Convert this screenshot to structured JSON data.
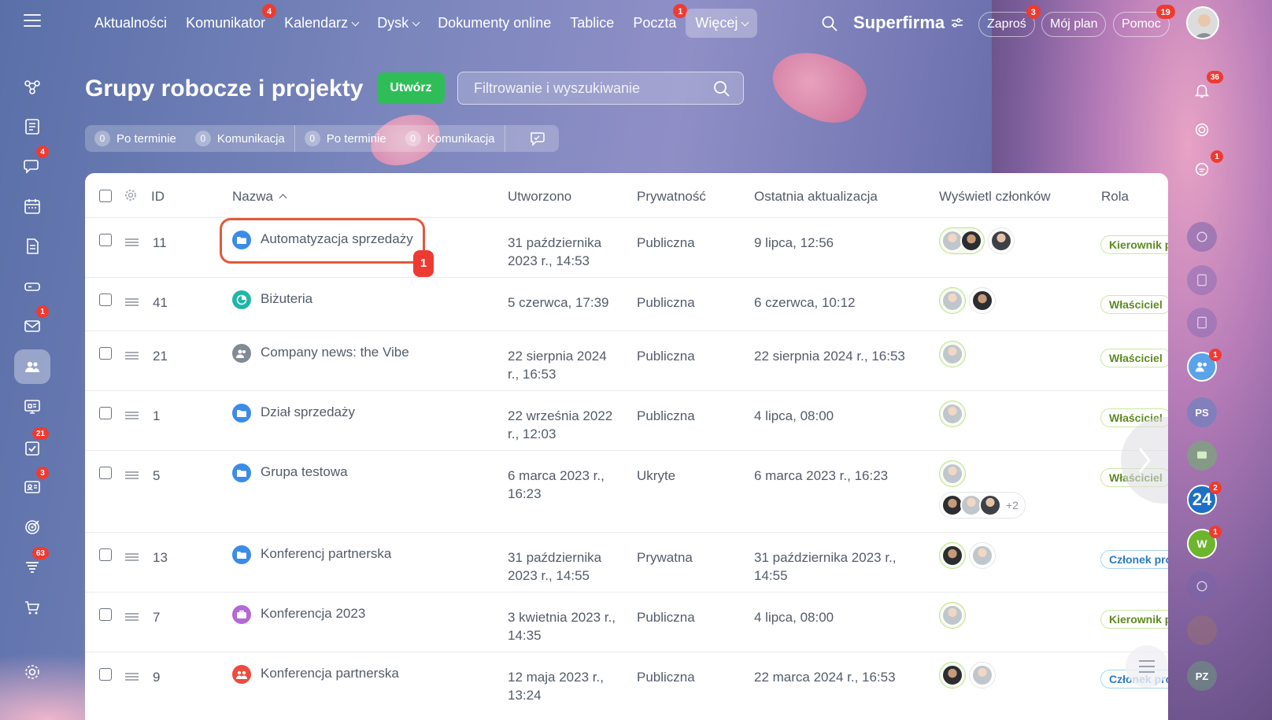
{
  "topbar": {
    "nav": [
      {
        "label": "Aktualności"
      },
      {
        "label": "Komunikator",
        "badge": "4"
      },
      {
        "label": "Kalendarz",
        "dropdown": true
      },
      {
        "label": "Dysk",
        "dropdown": true
      },
      {
        "label": "Dokumenty online"
      },
      {
        "label": "Tablice"
      },
      {
        "label": "Poczta",
        "badge": "1"
      },
      {
        "label": "Więcej",
        "dropdown": true,
        "active": true
      }
    ],
    "brand": "Superfirma",
    "invite": {
      "label": "Zaproś",
      "badge": "3"
    },
    "plan": {
      "label": "Mój plan"
    },
    "help": {
      "label": "Pomoc",
      "badge": "19"
    }
  },
  "sidebar": {
    "badges": {
      "chat": "4",
      "mail": "1",
      "tasks": "21",
      "crm": "3",
      "feed": "63"
    }
  },
  "right_sidebar": {
    "notifications_badge": "36",
    "messenger_badge": "1",
    "groups_badge": "1",
    "ps_label": "PS",
    "b24_label": "24",
    "b24_badge": "2",
    "w_label": "W",
    "w_badge": "1",
    "pz_label": "PZ"
  },
  "page": {
    "title": "Grupy robocze i projekty",
    "create_label": "Utwórz",
    "filter_placeholder": "Filtrowanie i wyszukiwanie"
  },
  "counters": [
    {
      "count": "0",
      "label": "Po terminie"
    },
    {
      "count": "0",
      "label": "Komunikacja"
    },
    {
      "count": "0",
      "label": "Po terminie"
    },
    {
      "count": "0",
      "label": "Komunikacja"
    }
  ],
  "table": {
    "headers": {
      "id": "ID",
      "name": "Nazwa",
      "created": "Utworzono",
      "privacy": "Prywatność",
      "updated": "Ostatnia aktualizacja",
      "members": "Wyświetl członków",
      "role": "Rola"
    },
    "rows": [
      {
        "id": "11",
        "name": "Automatyzacja sprzedaży",
        "created": "31 października 2023 r., 14:53",
        "privacy": "Publiczna",
        "updated": "9 lipca, 12:56",
        "role": "Kierownik projektu",
        "icon": "folder",
        "icon_color": "#3b8ce8"
      },
      {
        "id": "41",
        "name": "Biżuteria",
        "created": "5 czerwca, 17:39",
        "privacy": "Publiczna",
        "updated": "6 czerwca, 10:12",
        "role": "Właściciel",
        "icon": "pie",
        "icon_color": "#1fb7a6"
      },
      {
        "id": "21",
        "name": "Company news: the Vibe",
        "created": "22 sierpnia 2024 r., 16:53",
        "privacy": "Publiczna",
        "updated": "22 sierpnia 2024 r., 16:53",
        "role": "Właściciel",
        "icon": "people",
        "icon_color": "#828b95"
      },
      {
        "id": "1",
        "name": "Dział sprzedaży",
        "created": "22 września 2022 r., 12:03",
        "privacy": "Publiczna",
        "updated": "4 lipca, 08:00",
        "role": "Właściciel",
        "icon": "folder",
        "icon_color": "#3b8ce8"
      },
      {
        "id": "5",
        "name": "Grupa testowa",
        "created": "6 marca 2023 r., 16:23",
        "privacy": "Ukryte",
        "updated": "6 marca 2023 r., 16:23",
        "role": "Właściciel",
        "icon": "folder",
        "icon_color": "#3b8ce8",
        "more_members": "+2"
      },
      {
        "id": "13",
        "name": "Konferencj partnerska",
        "created": "31 października 2023 r., 14:55",
        "privacy": "Prywatna",
        "updated": "31 października 2023 r., 14:55",
        "role": "Członek projektu",
        "icon": "folder",
        "icon_color": "#3b8ce8"
      },
      {
        "id": "7",
        "name": "Konferencja 2023",
        "created": "3 kwietnia 2023 r., 14:35",
        "privacy": "Publiczna",
        "updated": "4 lipca, 08:00",
        "role": "Kierownik projektu",
        "icon": "briefcase",
        "icon_color": "#b468d6"
      },
      {
        "id": "9",
        "name": "Konferencja partnerska",
        "created": "12 maja 2023 r., 13:24",
        "privacy": "Publiczna",
        "updated": "22 marca 2024 r., 16:53",
        "role": "Członek projektu",
        "icon": "people",
        "icon_color": "#ee4b3e"
      }
    ]
  },
  "annotation_number": "1",
  "colors": {
    "accent_green": "#2fbd57",
    "badge_red": "#ee3b32",
    "highlight": "#e05a3a"
  }
}
